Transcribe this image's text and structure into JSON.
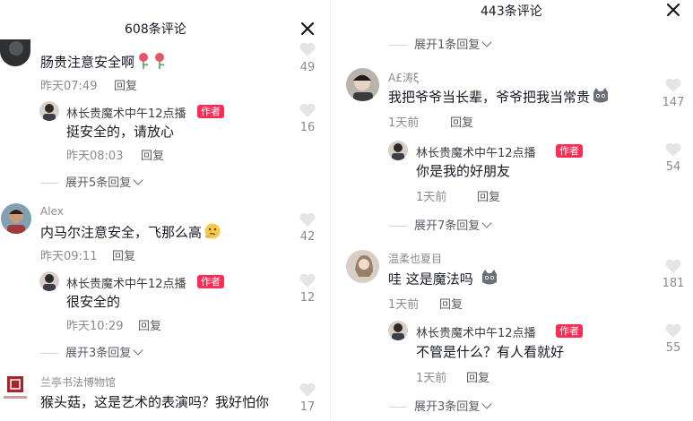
{
  "left": {
    "title": "608条评论",
    "comments": [
      {
        "user": "",
        "text": "肠贵注意安全啊",
        "emoji": [
          "rose-emoji",
          "rose-emoji"
        ],
        "time": "昨天07:49",
        "reply": "回复",
        "likes": "49"
      },
      {
        "user": "林长贵魔术中午12点播",
        "badge": "作者",
        "text": "挺安全的，请放心",
        "time": "昨天08:03",
        "reply": "回复",
        "likes": "16",
        "expand": "展开5条回复"
      },
      {
        "user": "Alex",
        "text": "内马尔注意安全，飞那么高",
        "emoji": [
          "thinking-emoji"
        ],
        "time": "昨天09:11",
        "reply": "回复",
        "likes": "42"
      },
      {
        "user": "林长贵魔术中午12点播",
        "badge": "作者",
        "text": "很安全的",
        "time": "昨天10:29",
        "reply": "回复",
        "likes": "12",
        "expand": "展开3条回复"
      },
      {
        "user": "兰亭书法博物馆",
        "text": "猴头菇，这是艺术的表演吗？我好怕你",
        "likes": "17"
      }
    ]
  },
  "right": {
    "title": "443条评论",
    "top_expand": "展开1条回复",
    "comments": [
      {
        "user": "A£涛ξ",
        "text": "我把爷爷当长辈，爷爷把我当常贵",
        "emoji": [
          "cat-emoji"
        ],
        "time": "1天前",
        "reply": "回复",
        "likes": "147"
      },
      {
        "user": "林长贵魔术中午12点播",
        "badge": "作者",
        "text": "你是我的好朋友",
        "time": "1天前",
        "reply": "回复",
        "likes": "54",
        "expand": "展开7条回复"
      },
      {
        "user": "温柔也夏目",
        "text": "哇 这是魔法吗",
        "emoji": [
          "cat-emoji"
        ],
        "time": "1天前",
        "reply": "回复",
        "likes": "181"
      },
      {
        "user": "林长贵魔术中午12点播",
        "badge": "作者",
        "text": "不管是什么？有人看就好",
        "time": "1天前",
        "reply": "回复",
        "likes": "55",
        "expand": "展开3条回复"
      }
    ]
  },
  "colors": {
    "accent": "#fe2c55",
    "muted": "#8a8b91",
    "text": "#161823"
  }
}
